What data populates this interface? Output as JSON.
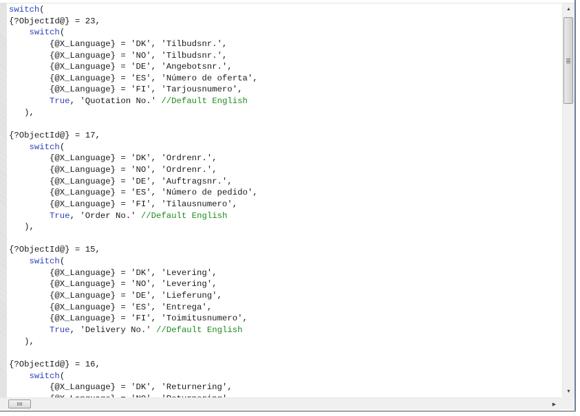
{
  "editor": {
    "language": "formula",
    "colors": {
      "keyword": "#2a3fb8",
      "comment": "#1e8a1e",
      "text": "#1a1a1a"
    },
    "lines": [
      [
        {
          "t": "switch",
          "c": "kw"
        },
        {
          "t": "(",
          "c": ""
        }
      ],
      [
        {
          "t": "{?ObjectId@} = 23,",
          "c": ""
        }
      ],
      [
        {
          "t": "    ",
          "c": ""
        },
        {
          "t": "switch",
          "c": "kw"
        },
        {
          "t": "(",
          "c": ""
        }
      ],
      [
        {
          "t": "        {@X_Language} = 'DK', 'Tilbudsnr.',",
          "c": ""
        }
      ],
      [
        {
          "t": "        {@X_Language} = 'NO', 'Tilbudsnr.',",
          "c": ""
        }
      ],
      [
        {
          "t": "        {@X_Language} = 'DE', 'Angebotsnr.',",
          "c": ""
        }
      ],
      [
        {
          "t": "        {@X_Language} = 'ES', 'Número de oferta',",
          "c": ""
        }
      ],
      [
        {
          "t": "        {@X_Language} = 'FI', 'Tarjousnumero',",
          "c": ""
        }
      ],
      [
        {
          "t": "        ",
          "c": ""
        },
        {
          "t": "True",
          "c": "kw"
        },
        {
          "t": ", 'Quotation No.' ",
          "c": ""
        },
        {
          "t": "//Default English",
          "c": "cm"
        }
      ],
      [
        {
          "t": "   ),",
          "c": ""
        }
      ],
      [
        {
          "t": "",
          "c": ""
        }
      ],
      [
        {
          "t": "{?ObjectId@} = 17,",
          "c": ""
        }
      ],
      [
        {
          "t": "    ",
          "c": ""
        },
        {
          "t": "switch",
          "c": "kw"
        },
        {
          "t": "(",
          "c": ""
        }
      ],
      [
        {
          "t": "        {@X_Language} = 'DK', 'Ordrenr.',",
          "c": ""
        }
      ],
      [
        {
          "t": "        {@X_Language} = 'NO', 'Ordrenr.',",
          "c": ""
        }
      ],
      [
        {
          "t": "        {@X_Language} = 'DE', 'Auftragsnr.',",
          "c": ""
        }
      ],
      [
        {
          "t": "        {@X_Language} = 'ES', 'Número de pedido',",
          "c": ""
        }
      ],
      [
        {
          "t": "        {@X_Language} = 'FI', 'Tilausnumero',",
          "c": ""
        }
      ],
      [
        {
          "t": "        ",
          "c": ""
        },
        {
          "t": "True",
          "c": "kw"
        },
        {
          "t": ", 'Order No.' ",
          "c": ""
        },
        {
          "t": "//Default English",
          "c": "cm"
        }
      ],
      [
        {
          "t": "   ),",
          "c": ""
        }
      ],
      [
        {
          "t": "",
          "c": ""
        }
      ],
      [
        {
          "t": "{?ObjectId@} = 15,",
          "c": ""
        }
      ],
      [
        {
          "t": "    ",
          "c": ""
        },
        {
          "t": "switch",
          "c": "kw"
        },
        {
          "t": "(",
          "c": ""
        }
      ],
      [
        {
          "t": "        {@X_Language} = 'DK', 'Levering',",
          "c": ""
        }
      ],
      [
        {
          "t": "        {@X_Language} = 'NO', 'Levering',",
          "c": ""
        }
      ],
      [
        {
          "t": "        {@X_Language} = 'DE', 'Lieferung',",
          "c": ""
        }
      ],
      [
        {
          "t": "        {@X_Language} = 'ES', 'Entrega',",
          "c": ""
        }
      ],
      [
        {
          "t": "        {@X_Language} = 'FI', 'Toimitusnumero',",
          "c": ""
        }
      ],
      [
        {
          "t": "        ",
          "c": ""
        },
        {
          "t": "True",
          "c": "kw"
        },
        {
          "t": ", 'Delivery No.' ",
          "c": ""
        },
        {
          "t": "//Default English",
          "c": "cm"
        }
      ],
      [
        {
          "t": "   ),",
          "c": ""
        }
      ],
      [
        {
          "t": "",
          "c": ""
        }
      ],
      [
        {
          "t": "{?ObjectId@} = 16,",
          "c": ""
        }
      ],
      [
        {
          "t": "    ",
          "c": ""
        },
        {
          "t": "switch",
          "c": "kw"
        },
        {
          "t": "(",
          "c": ""
        }
      ],
      [
        {
          "t": "        {@X_Language} = 'DK', 'Returnering',",
          "c": ""
        }
      ],
      [
        {
          "t": "        {@X_Language} = 'NO', 'Returnering',",
          "c": ""
        }
      ]
    ]
  },
  "scrollbars": {
    "vertical": {
      "up_icon": "▲",
      "down_icon": "▼",
      "position_fraction": 0.0
    },
    "horizontal": {
      "left_icon": "◀",
      "right_icon": "▶",
      "position_fraction": 0.0
    }
  }
}
